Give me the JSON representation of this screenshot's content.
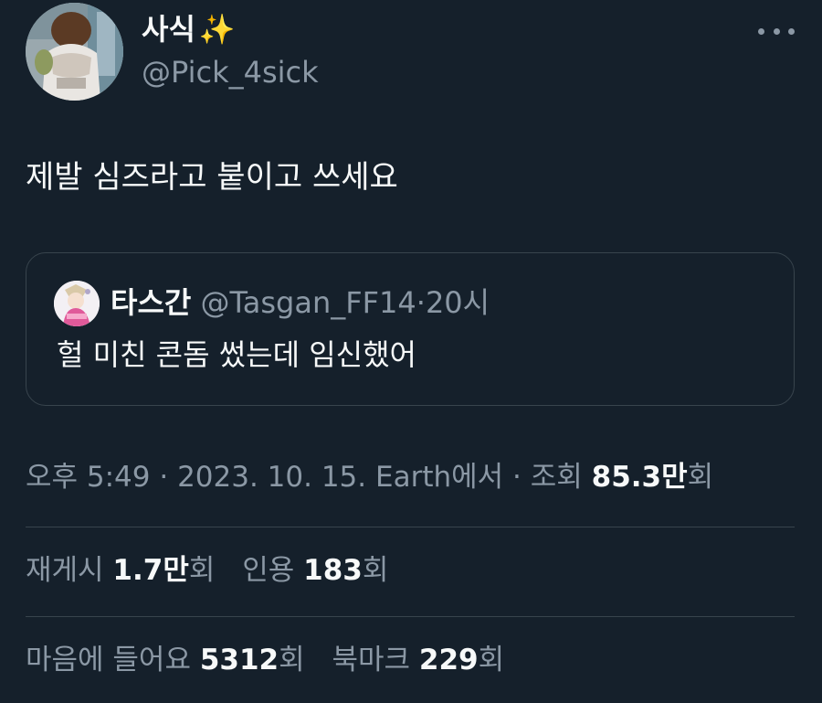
{
  "author": {
    "display_name": "사식",
    "emoji": "✨",
    "handle": "@Pick_4sick"
  },
  "tweet": {
    "text": "제발 심즈라고 붙이고 쓰세요"
  },
  "quoted": {
    "display_name": "타스간",
    "handle": "@Tasgan_FF14",
    "dot": "·",
    "time": "20시",
    "text": "헐 미친 콘돔 썼는데 임신했어"
  },
  "meta": {
    "time": "오후 5:49",
    "sep1": " · ",
    "date": "2023. 10. 15.",
    "source": " Earth에서",
    "sep2": " · ",
    "views_label": "조회 ",
    "views_value": "85.3만",
    "views_suffix": "회"
  },
  "stats": {
    "retweets_label": "재게시 ",
    "retweets_value": "1.7만",
    "retweets_suffix": "회",
    "quotes_label": "인용 ",
    "quotes_value": "183",
    "quotes_suffix": "회",
    "likes_label": "마음에 들어요 ",
    "likes_value": "5312",
    "likes_suffix": "회",
    "bookmarks_label": "북마크 ",
    "bookmarks_value": "229",
    "bookmarks_suffix": "회"
  },
  "colors": {
    "background": "#15202b",
    "text_primary": "#f7f9f9",
    "text_secondary": "#8b98a5",
    "border": "#38444d"
  }
}
